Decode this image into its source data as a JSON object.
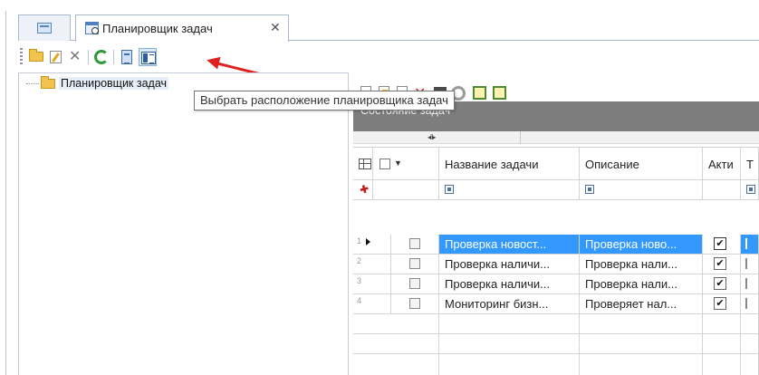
{
  "tabs": {
    "active_label": "Планировщик задач",
    "close_glyph": "✕"
  },
  "tree": {
    "root_label": "Планировщик задач"
  },
  "tooltip": {
    "text": "Выбрать расположение планировщика задач"
  },
  "state_panel": {
    "title": "Состояние задач",
    "splitter_glyph": "◂‖▸"
  },
  "grid": {
    "columns": [
      "Название задачи",
      "Описание",
      "Акти",
      "Т"
    ],
    "rows": [
      {
        "num": "1",
        "name": "Проверка новост...",
        "desc": "Проверка ново...",
        "active": "✔",
        "type": "",
        "selected": true
      },
      {
        "num": "2",
        "name": "Проверка наличи...",
        "desc": "Проверка нали...",
        "active": "✔",
        "type": "",
        "selected": false
      },
      {
        "num": "3",
        "name": "Проверка наличи...",
        "desc": "Проверка нали...",
        "active": "✔",
        "type": "",
        "selected": false
      },
      {
        "num": "4",
        "name": "Мониторинг бизн...",
        "desc": "Проверяет нал...",
        "active": "✔",
        "type": "",
        "selected": false
      }
    ]
  },
  "colors": {
    "selection": "#3399ff",
    "state_header_bg": "#7d7d7d",
    "arrow": "#e02020"
  },
  "icons": {
    "toolbar": [
      "open-folder-icon",
      "edit-icon",
      "delete-icon",
      "refresh-icon",
      "book-icon",
      "panel-layout-icon"
    ],
    "grid_toolbar": [
      "new-doc-icon",
      "edit-doc-icon",
      "copy-doc-icon",
      "delete-icon",
      "stop-icon",
      "record-icon",
      "export-icon",
      "import-icon"
    ]
  }
}
